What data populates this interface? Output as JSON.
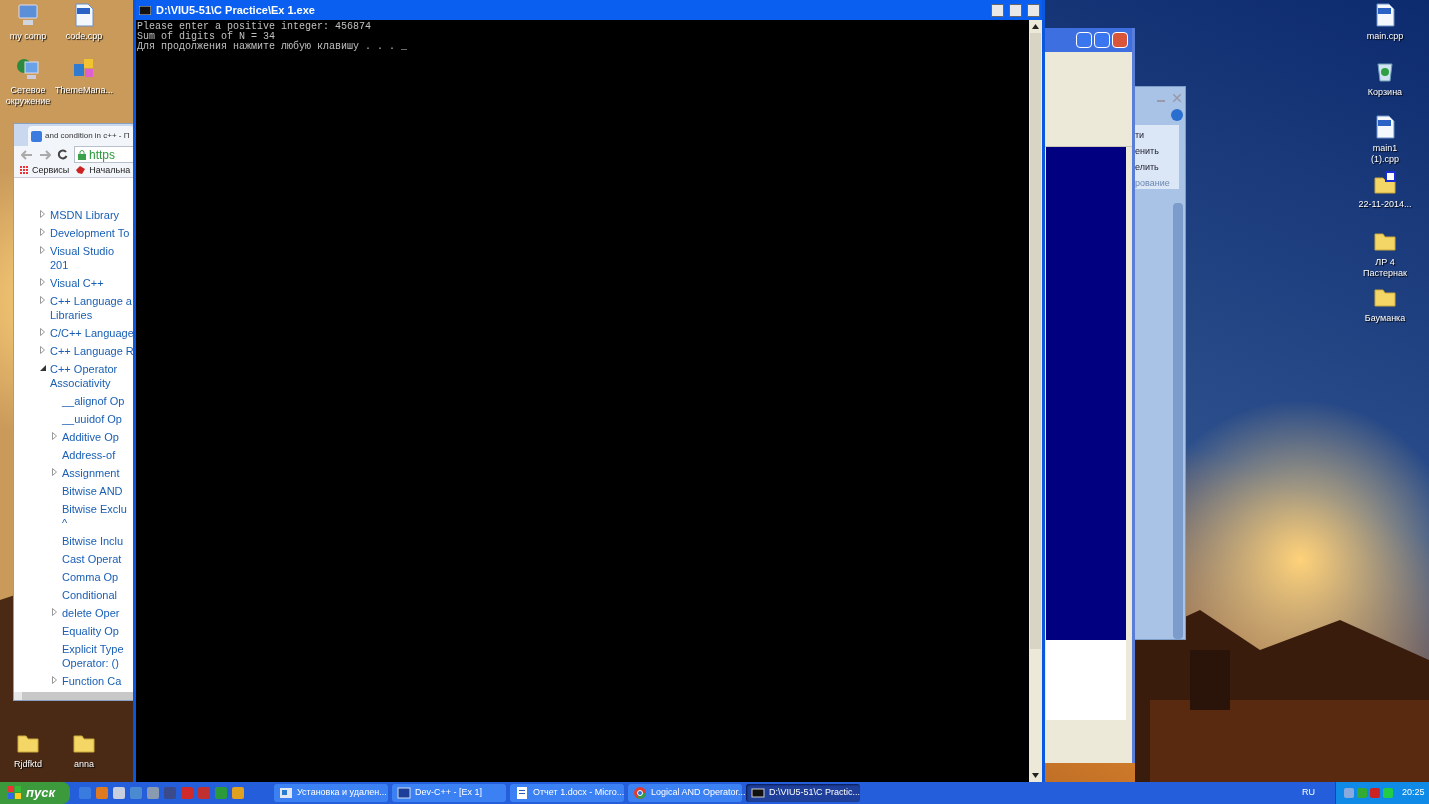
{
  "desktop_left": [
    {
      "label": "my comp",
      "kind": "computer"
    },
    {
      "label": "code.cpp",
      "kind": "cpp"
    },
    {
      "label": "Сетевое окружение",
      "kind": "network"
    },
    {
      "label": "ThemeMana...",
      "kind": "app"
    },
    {
      "label": "Rjdfktd",
      "kind": "folder"
    },
    {
      "label": "anna",
      "kind": "folder"
    }
  ],
  "desktop_right": [
    {
      "label": "main.cpp",
      "kind": "cpp"
    },
    {
      "label": "Корзина",
      "kind": "recycle"
    },
    {
      "label": "main1 (1).cpp",
      "kind": "cpp"
    },
    {
      "label": "22-11-2014...",
      "kind": "archive"
    },
    {
      "label": "ЛР 4 Пастернак",
      "kind": "folder"
    },
    {
      "label": "Бауманка",
      "kind": "folder"
    }
  ],
  "browser": {
    "tab_title": "and condition in c++ - П",
    "address": "https",
    "bookmarks": [
      {
        "label": "Сервисы",
        "kind": "apps"
      },
      {
        "label": "Начальна",
        "kind": "bird"
      }
    ],
    "tree": [
      {
        "label": "MSDN Library",
        "kind": "branch",
        "expanded": false
      },
      {
        "label": "Development To",
        "kind": "branch",
        "expanded": false
      },
      {
        "label": "Visual Studio 201",
        "kind": "branch",
        "expanded": false
      },
      {
        "label": "Visual C++",
        "kind": "branch",
        "expanded": false
      },
      {
        "label": "C++ Language a\nLibraries",
        "kind": "branch",
        "expanded": false
      },
      {
        "label": "C/C++ Language",
        "kind": "branch",
        "expanded": false
      },
      {
        "label": "C++ Language R",
        "kind": "branch",
        "expanded": false
      },
      {
        "label": "C++ Operator\nAssociativity",
        "kind": "branch",
        "expanded": true,
        "children": [
          {
            "label": "__alignof Op",
            "kind": "leaf"
          },
          {
            "label": "__uuidof Op",
            "kind": "leaf"
          },
          {
            "label": "Additive Op",
            "kind": "branch",
            "expanded": false
          },
          {
            "label": "Address-of",
            "kind": "leaf"
          },
          {
            "label": "Assignment",
            "kind": "branch",
            "expanded": false
          },
          {
            "label": "Bitwise AND",
            "kind": "leaf"
          },
          {
            "label": "Bitwise Exclu\n^",
            "kind": "leaf"
          },
          {
            "label": "Bitwise Inclu",
            "kind": "leaf"
          },
          {
            "label": "Cast Operat",
            "kind": "leaf"
          },
          {
            "label": "Comma Op",
            "kind": "leaf"
          },
          {
            "label": "Conditional",
            "kind": "leaf"
          },
          {
            "label": "delete Oper",
            "kind": "branch",
            "expanded": false
          },
          {
            "label": "Equality Op",
            "kind": "leaf"
          },
          {
            "label": "Explicit Type\nOperator: ()",
            "kind": "leaf"
          },
          {
            "label": "Function Ca",
            "kind": "branch",
            "expanded": false
          }
        ]
      }
    ]
  },
  "console": {
    "title": "D:\\VIU5-51\\C Practice\\Ex 1.exe",
    "lines": [
      "Please enter a positive integer: 456874",
      "Sum of digits of N = 34",
      "Для продолжения нажмите любую клавишу . . . _"
    ]
  },
  "word": {
    "ribbon_items": [
      "ти",
      "енить",
      "елить"
    ],
    "group_label": "рование"
  },
  "taskbar": {
    "start": "пуск",
    "tasks": [
      {
        "label": "Установка и удален...",
        "kind": "installer",
        "selected": false
      },
      {
        "label": "Dev-C++ - [Ex 1]",
        "kind": "ide",
        "selected": false
      },
      {
        "label": "Отчет 1.docx - Micro...",
        "kind": "document",
        "selected": false
      },
      {
        "label": "Logical AND Operator...",
        "kind": "browser",
        "selected": false
      },
      {
        "label": "D:\\VIU5-51\\C Practic...",
        "kind": "console",
        "selected": true
      }
    ],
    "language": "RU",
    "clock": "20:25"
  }
}
